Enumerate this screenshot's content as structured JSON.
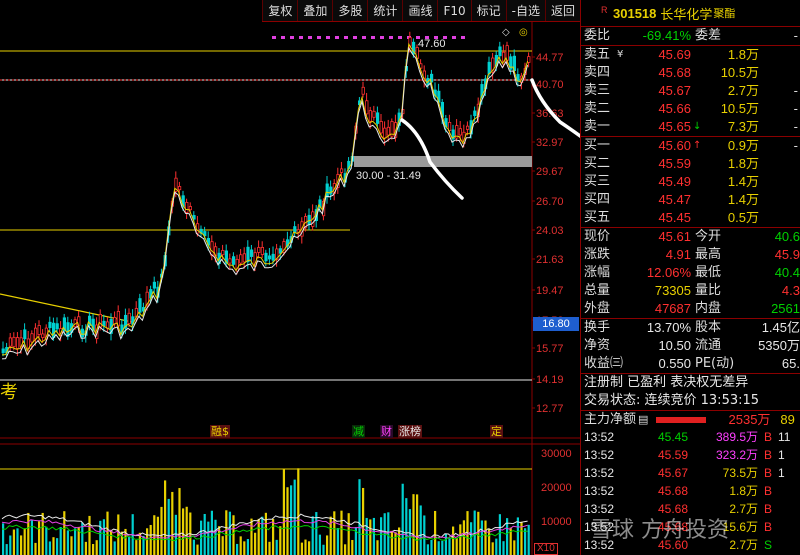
{
  "toolbar": [
    "复权",
    "叠加",
    "多股",
    "统计",
    "画线",
    "F10",
    "标记",
    "-自选",
    "返回"
  ],
  "price_axis": [
    "44.77",
    "40.70",
    "36.63",
    "32.97",
    "29.67",
    "26.70",
    "24.03",
    "21.63",
    "19.47",
    "17.52",
    "15.77",
    "14.19",
    "12.77"
  ],
  "volume_axis": [
    "30000",
    "20000",
    "10000"
  ],
  "volume_multiplier": "X10",
  "current_price_tag": "16.80",
  "annotations": {
    "range": "30.00 - 31.49",
    "high": "47.60",
    "left_char": "考"
  },
  "event_tags": [
    {
      "text": "融$",
      "color": "#e8d000",
      "bg": "#5a1010"
    },
    {
      "text": "减",
      "color": "#00d000",
      "bg": "#0a2a0a"
    },
    {
      "text": "财",
      "color": "#ff40ff",
      "bg": "#2a0a2a"
    },
    {
      "text": "涨榜",
      "color": "#e8e8e8",
      "bg": "#5a1010"
    },
    {
      "text": "定",
      "color": "#e8d000",
      "bg": "#5a1010"
    }
  ],
  "colors": {
    "up": "#ff3030",
    "down": "#00d0d0",
    "ma_yellow": "#e8d000",
    "ma_white": "#e8e8e8",
    "ma_magenta": "#e040e0",
    "ma_green": "#00d000",
    "axis": "#8b0000"
  },
  "stock": {
    "r_mark": "R",
    "code": "301518",
    "name": "长华化学",
    "tag": "聚酯"
  },
  "commission": {
    "label1": "委比",
    "value1": "-69.41%",
    "label2": "委差",
    "value2": "-"
  },
  "sell_orders": [
    {
      "label": "卖五",
      "mark": "¥",
      "price": "45.69",
      "volume": "1.8万",
      "change": ""
    },
    {
      "label": "卖四",
      "mark": "",
      "price": "45.68",
      "volume": "10.5万",
      "change": ""
    },
    {
      "label": "卖三",
      "mark": "",
      "price": "45.67",
      "volume": "2.7万",
      "change": "-"
    },
    {
      "label": "卖二",
      "mark": "",
      "price": "45.66",
      "volume": "10.5万",
      "change": "-"
    },
    {
      "label": "卖一",
      "mark": "↓",
      "price": "45.65",
      "volume": "7.3万",
      "change": "-"
    }
  ],
  "buy_orders": [
    {
      "label": "买一",
      "mark": "↑",
      "price": "45.60",
      "volume": "0.9万",
      "change": "-"
    },
    {
      "label": "买二",
      "mark": "",
      "price": "45.59",
      "volume": "1.8万",
      "change": ""
    },
    {
      "label": "买三",
      "mark": "",
      "price": "45.49",
      "volume": "1.4万",
      "change": ""
    },
    {
      "label": "买四",
      "mark": "",
      "price": "45.47",
      "volume": "1.4万",
      "change": ""
    },
    {
      "label": "买五",
      "mark": "",
      "price": "45.45",
      "volume": "0.5万",
      "change": ""
    }
  ],
  "stats": [
    {
      "l1": "现价",
      "v1": "45.61",
      "c1": "red",
      "l2": "今开",
      "v2": "40.6",
      "c2": "green"
    },
    {
      "l1": "涨跌",
      "v1": "4.91",
      "c1": "red",
      "l2": "最高",
      "v2": "45.9",
      "c2": "red"
    },
    {
      "l1": "涨幅",
      "v1": "12.06%",
      "c1": "red",
      "l2": "最低",
      "v2": "40.4",
      "c2": "green"
    },
    {
      "l1": "总量",
      "v1": "73305",
      "c1": "yellow",
      "l2": "量比",
      "v2": "4.3",
      "c2": "red"
    },
    {
      "l1": "外盘",
      "v1": "47687",
      "c1": "red",
      "l2": "内盘",
      "v2": "2561",
      "c2": "green"
    }
  ],
  "stats2": [
    {
      "l1": "换手",
      "v1": "13.70%",
      "c1": "white",
      "l2": "股本",
      "v2": "1.45亿",
      "c2": "white"
    },
    {
      "l1": "净资",
      "v1": "10.50",
      "c1": "white",
      "l2": "流通",
      "v2": "5350万",
      "c2": "white"
    },
    {
      "l1": "收益㈢",
      "v1": "0.550",
      "c1": "white",
      "l2": "PE(动)",
      "v2": "65.",
      "c2": "white"
    }
  ],
  "info_lines": [
    "注册制 已盈利 表决权无差异",
    "交易状态: 连续竞价  13:53:15"
  ],
  "main_flow": {
    "label": "主力净额",
    "value": "2535万",
    "extra": "89"
  },
  "ticks": [
    {
      "time": "13:52",
      "price": "45.45",
      "pc": "green",
      "vol": "389.5万",
      "vc": "magenta",
      "bs": "B",
      "n": "11"
    },
    {
      "time": "13:52",
      "price": "45.59",
      "pc": "red",
      "vol": "323.2万",
      "vc": "magenta",
      "bs": "B",
      "n": "1"
    },
    {
      "time": "13:52",
      "price": "45.67",
      "pc": "red",
      "vol": "73.5万",
      "vc": "yellow",
      "bs": "B",
      "n": "1"
    },
    {
      "time": "13:52",
      "price": "45.68",
      "pc": "red",
      "vol": "1.8万",
      "vc": "yellow",
      "bs": "B",
      "n": ""
    },
    {
      "time": "13:52",
      "price": "45.68",
      "pc": "red",
      "vol": "2.7万",
      "vc": "yellow",
      "bs": "B",
      "n": ""
    },
    {
      "time": "13:52",
      "price": "45.68",
      "pc": "red",
      "vol": "15.6万",
      "vc": "yellow",
      "bs": "B",
      "n": ""
    },
    {
      "time": "13:52",
      "price": "45.60",
      "pc": "red",
      "vol": "2.7万",
      "vc": "yellow",
      "bs": "S",
      "n": ""
    }
  ],
  "watermark": "雪球 方舟投资"
}
